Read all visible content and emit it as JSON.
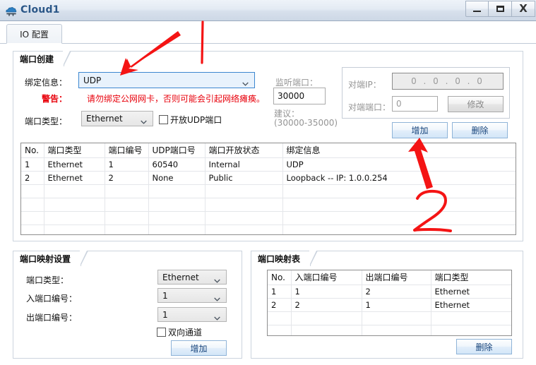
{
  "window": {
    "title": "Cloud1",
    "icon": "cloud-device-icon",
    "minimize_label": "–",
    "maximize_label": "□",
    "close_label": "X"
  },
  "tabs": [
    {
      "label": "IO 配置",
      "selected": true
    }
  ],
  "port_create": {
    "group_title": "端口创建",
    "bind_info_label": "绑定信息：",
    "bind_info_value": "UDP",
    "warning_label": "警告：",
    "warning_text": "请勿绑定公网网卡，否则可能会引起网络瘫痪。",
    "port_type_label": "端口类型：",
    "port_type_value": "Ethernet",
    "open_udp_label": "开放UDP端口",
    "open_udp_checked": false,
    "listen_port_label": "监听端口：",
    "listen_port_value": "30000",
    "suggest_label_1": "建议：",
    "suggest_label_2": "(30000-35000)",
    "peer_ip_label": "对端IP：",
    "peer_ip_value": "0 . 0 . 0 . 0",
    "peer_port_label": "对端端口：",
    "peer_port_value": "0",
    "modify_button": "修改",
    "add_button": "增加",
    "delete_button": "删除"
  },
  "port_table": {
    "columns": [
      "No.",
      "端口类型",
      "端口编号",
      "UDP端口号",
      "端口开放状态",
      "绑定信息"
    ],
    "rows": [
      [
        "1",
        "Ethernet",
        "1",
        "60540",
        "Internal",
        "UDP"
      ],
      [
        "2",
        "Ethernet",
        "2",
        "None",
        "Public",
        "Loopback -- IP: 1.0.0.254"
      ]
    ],
    "empty_rows": 5
  },
  "port_map_settings": {
    "group_title": "端口映射设置",
    "port_type_label": "端口类型：",
    "port_type_value": "Ethernet",
    "in_port_label": "入端口编号：",
    "in_port_value": "1",
    "out_port_label": "出端口编号：",
    "out_port_value": "1",
    "bidirectional_label": "双向通道",
    "bidirectional_checked": false,
    "add_button": "增加"
  },
  "port_map_table": {
    "group_title": "端口映射表",
    "columns": [
      "No.",
      "入端口编号",
      "出端口编号",
      "端口类型"
    ],
    "rows": [
      [
        "1",
        "1",
        "2",
        "Ethernet"
      ],
      [
        "2",
        "2",
        "1",
        "Ethernet"
      ]
    ],
    "empty_rows": 4,
    "delete_button": "删除"
  },
  "annotations": {
    "marker_one": "1",
    "marker_two": "2",
    "arrow_one_target": "绑定信息 combobox",
    "arrow_two_target": "增加 button",
    "color": "#f41414"
  }
}
